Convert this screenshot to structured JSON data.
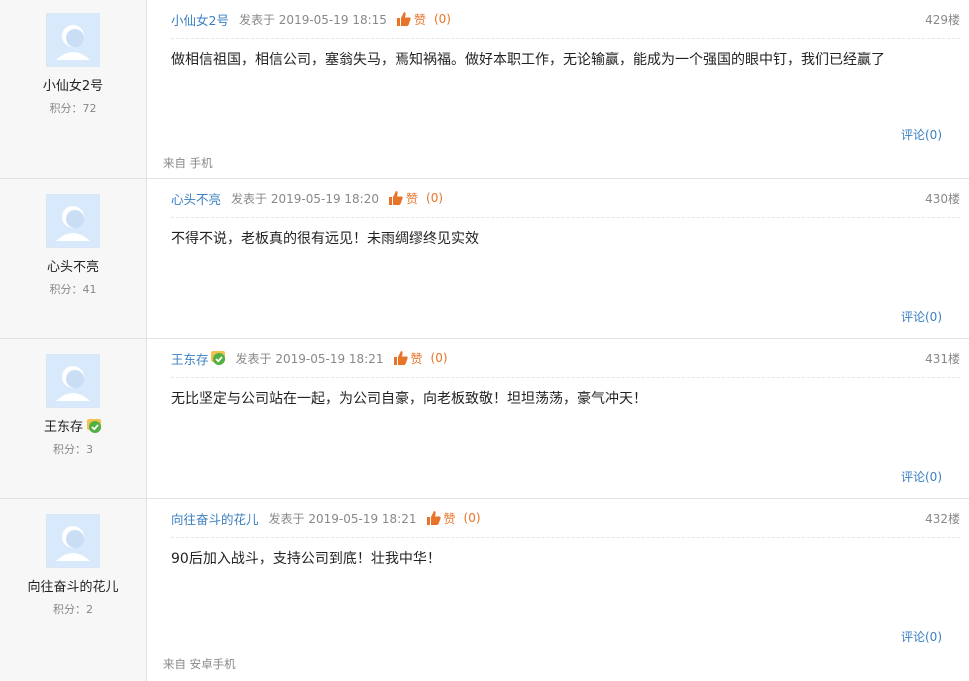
{
  "labels": {
    "score_prefix": "积分：",
    "posted_prefix": "发表于",
    "like_text": "赞"
  },
  "colors": {
    "link_blue": "#3a7fc1",
    "like_orange": "#e8742a",
    "side_bg": "#f7f7f7",
    "avatar_bg": "#d8e9fb"
  },
  "posts": [
    {
      "author": "小仙女2号",
      "score": "72",
      "time": "2019-05-19 18:15",
      "likes": "(0)",
      "floor": "429楼",
      "content": "做相信祖国，相信公司，塞翁失马，焉知祸福。做好本职工作，无论输赢，能成为一个强国的眼中钉，我们已经赢了",
      "comment": "评论(0)",
      "source": "来自 手机",
      "badge": false
    },
    {
      "author": "心头不亮",
      "score": "41",
      "time": "2019-05-19 18:20",
      "likes": "(0)",
      "floor": "430楼",
      "content": "不得不说，老板真的很有远见！未雨绸缪终见实效",
      "comment": "评论(0)",
      "source": "",
      "badge": false
    },
    {
      "author": "王东存",
      "score": "3",
      "time": "2019-05-19 18:21",
      "likes": "(0)",
      "floor": "431楼",
      "content": "无比坚定与公司站在一起，为公司自豪，向老板致敬！坦坦荡荡，豪气冲天！",
      "comment": "评论(0)",
      "source": "",
      "badge": true
    },
    {
      "author": "向往奋斗的花儿",
      "score": "2",
      "time": "2019-05-19 18:21",
      "likes": "(0)",
      "floor": "432楼",
      "content": "90后加入战斗，支持公司到底！壮我中华！",
      "comment": "评论(0)",
      "source": "来自 安卓手机",
      "badge": false
    }
  ]
}
